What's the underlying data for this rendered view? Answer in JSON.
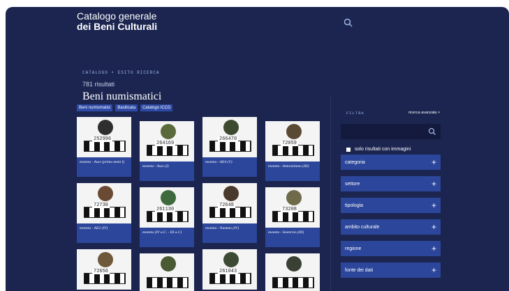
{
  "header": {
    "brand_line1": "Catalogo generale",
    "brand_line2": "dei Beni Culturali",
    "search_icon": "search-icon"
  },
  "breadcrumb": "CATALOGO • ESITO RICERCA",
  "results_count": "781 risultati",
  "page_title": "Beni numismatici",
  "chips": [
    "Beni numismatici",
    "Basilicata",
    "Catalogo ICCD"
  ],
  "cards": [
    {
      "caption": "moneta - Asse (prima metà I)",
      "inv": "252996",
      "coin": "#2f2f2f"
    },
    {
      "caption": "moneta - Asse (I)",
      "inv": "264169",
      "coin": "#5b6a3a"
    },
    {
      "caption": "moneta - AE4 (V)",
      "inv": "266470",
      "coin": "#3d4a2f"
    },
    {
      "caption": "moneta - Antoniniano (III)",
      "inv": "72059",
      "coin": "#5a4a34"
    },
    {
      "caption": "moneta - AE2 (IV)",
      "inv": "72730",
      "coin": "#6b4a33"
    },
    {
      "caption": "moneta (IV a.C. - III a.C)",
      "inv": "261130",
      "coin": "#3f6a3d"
    },
    {
      "caption": "moneta - Nummo (IV)",
      "inv": "72648",
      "coin": "#4a3a2e"
    },
    {
      "caption": "moneta - Sesterzio (III)",
      "inv": "73208",
      "coin": "#6e6a4a"
    },
    {
      "caption": "",
      "inv": "72656",
      "coin": "#6e5a3a"
    },
    {
      "caption": "",
      "inv": "",
      "coin": "#4a5a33"
    },
    {
      "caption": "",
      "inv": "261043",
      "coin": "#3d4a33"
    },
    {
      "caption": "",
      "inv": "",
      "coin": "#3a4033"
    }
  ],
  "filter": {
    "title": "FILTRA",
    "advanced": "ricerca avanzata >",
    "only_images": "solo risultati con immagini",
    "facets": [
      "categoria",
      "settore",
      "tipologia",
      "ambito culturale",
      "regione",
      "fonte dei dati"
    ]
  },
  "colors": {
    "background": "#1b2550",
    "accent": "#2b469b"
  }
}
